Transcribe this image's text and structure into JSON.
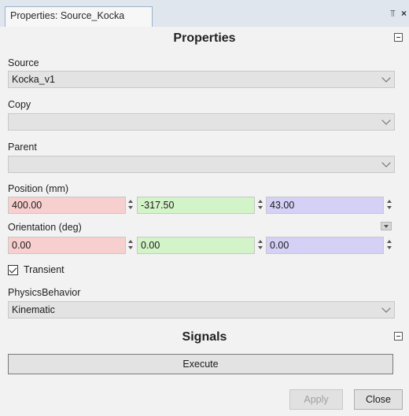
{
  "tab": {
    "title": "Properties: Source_Kocka",
    "dropdown_icon": "pin-dropdown-icon",
    "close_icon": "close-icon"
  },
  "properties": {
    "header": "Properties",
    "source": {
      "label": "Source",
      "value": "Kocka_v1"
    },
    "copy": {
      "label": "Copy",
      "value": ""
    },
    "parent": {
      "label": "Parent",
      "value": ""
    },
    "position": {
      "label": "Position (mm)",
      "x": "400.00",
      "y": "-317.50",
      "z": "43.00"
    },
    "orientation": {
      "label": "Orientation (deg)",
      "x": "0.00",
      "y": "0.00",
      "z": "0.00"
    },
    "transient": {
      "label": "Transient",
      "checked": true
    },
    "physics": {
      "label": "PhysicsBehavior",
      "value": "Kinematic"
    }
  },
  "signals": {
    "header": "Signals",
    "execute_label": "Execute"
  },
  "footer": {
    "apply_label": "Apply",
    "close_label": "Close"
  },
  "colors": {
    "x_axis": "#f8cfcf",
    "y_axis": "#d3f3c8",
    "z_axis": "#d4d0f6"
  }
}
